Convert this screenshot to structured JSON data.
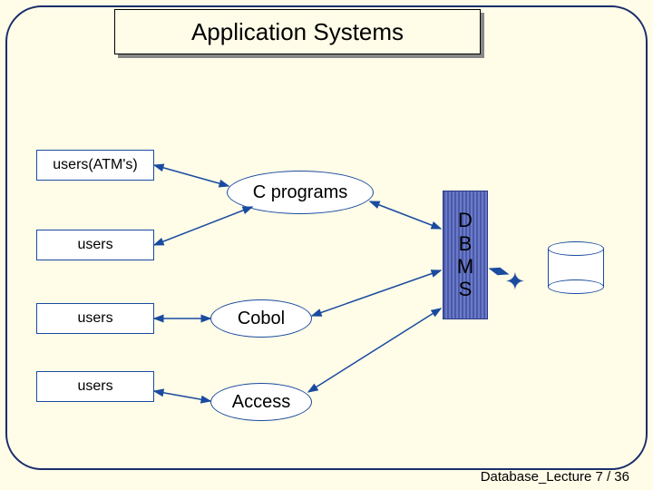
{
  "title": "Application Systems",
  "user_boxes": {
    "u1": "users(ATM's)",
    "u2": "users",
    "u3": "users",
    "u4": "users"
  },
  "programs": {
    "p1": "C programs",
    "p2": "Cobol",
    "p3": "Access"
  },
  "dbms": "D\nB\nM\nS",
  "footer": "Database_Lecture 7 /  36"
}
